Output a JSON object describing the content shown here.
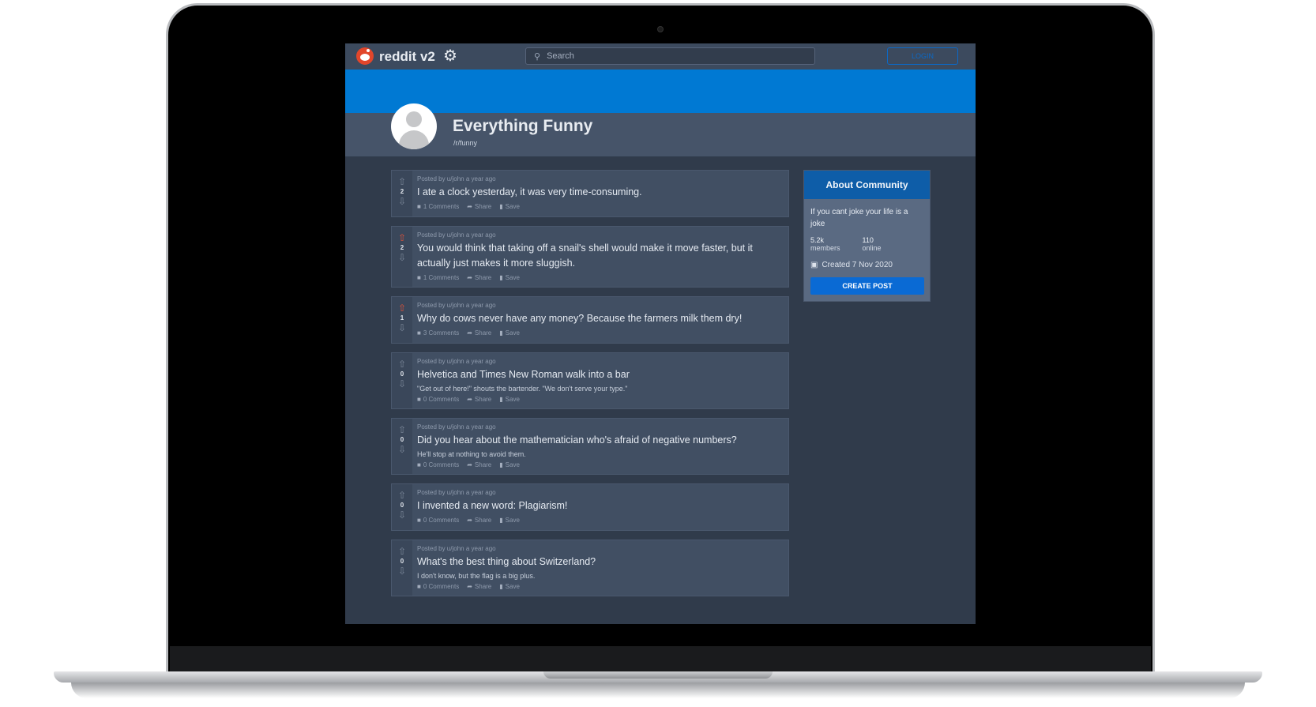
{
  "header": {
    "brand": "reddit v2",
    "search_placeholder": "Search",
    "login_label": "LOGIN"
  },
  "community": {
    "name": "Everything Funny",
    "slug": "/r/funny"
  },
  "posts": [
    {
      "meta": "Posted by u/john a year ago",
      "title": "I ate a clock yesterday, it was very time-consuming.",
      "body": "",
      "votes": "2",
      "upvoted": false,
      "comments": "1 Comments",
      "share": "Share",
      "save": "Save"
    },
    {
      "meta": "Posted by u/john a year ago",
      "title": "You would think that taking off a snail's shell would make it move faster, but it actually just makes it more sluggish.",
      "body": "",
      "votes": "2",
      "upvoted": true,
      "comments": "1 Comments",
      "share": "Share",
      "save": "Save"
    },
    {
      "meta": "Posted by u/john a year ago",
      "title": "Why do cows never have any money? Because the farmers milk them dry!",
      "body": "",
      "votes": "1",
      "upvoted": true,
      "comments": "3 Comments",
      "share": "Share",
      "save": "Save"
    },
    {
      "meta": "Posted by u/john a year ago",
      "title": "Helvetica and Times New Roman walk into a bar",
      "body": "\"Get out of here!\" shouts the bartender. \"We don't serve your type.\"",
      "votes": "0",
      "upvoted": false,
      "comments": "0 Comments",
      "share": "Share",
      "save": "Save"
    },
    {
      "meta": "Posted by u/john a year ago",
      "title": "Did you hear about the mathematician who's afraid of negative numbers?",
      "body": "He'll stop at nothing to avoid them.",
      "votes": "0",
      "upvoted": false,
      "comments": "0 Comments",
      "share": "Share",
      "save": "Save"
    },
    {
      "meta": "Posted by u/john a year ago",
      "title": "I invented a new word: Plagiarism!",
      "body": "",
      "votes": "0",
      "upvoted": false,
      "comments": "0 Comments",
      "share": "Share",
      "save": "Save"
    },
    {
      "meta": "Posted by u/john a year ago",
      "title": "What's the best thing about Switzerland?",
      "body": "I don't know, but the flag is a big plus.",
      "votes": "0",
      "upvoted": false,
      "comments": "0 Comments",
      "share": "Share",
      "save": "Save"
    }
  ],
  "sidebar": {
    "title": "About Community",
    "description": "If you cant joke your life is a joke",
    "members_value": "5.2k",
    "members_label": "members",
    "online_value": "110",
    "online_label": "online",
    "created": "Created 7 Nov 2020",
    "create_post_label": "CREATE POST"
  },
  "colors": {
    "banner": "#0079d3",
    "upvote_active": "#e0533a",
    "accent_button": "#0a6ad4"
  },
  "icons": {
    "logo": "reddit-logo-icon",
    "theme": "gear-icon",
    "search": "search-icon",
    "upvote": "arrow-up-icon",
    "downvote": "arrow-down-icon",
    "comments": "comment-icon",
    "share": "share-icon",
    "save": "bookmark-icon",
    "created": "cake-icon"
  }
}
